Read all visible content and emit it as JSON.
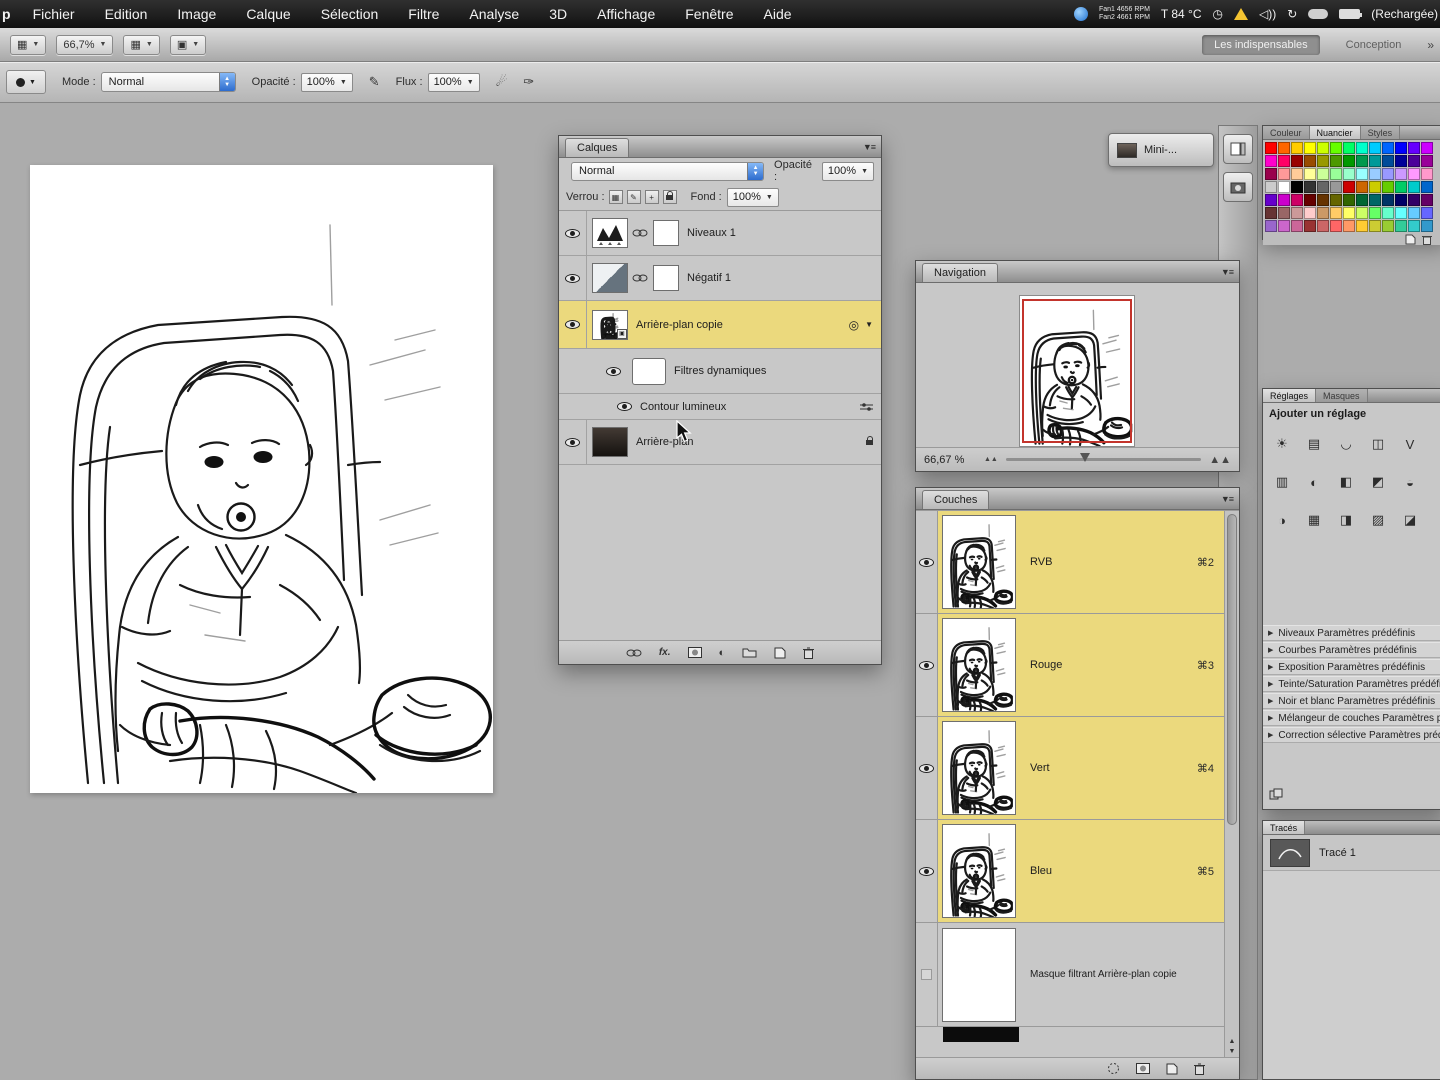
{
  "menu_bar": {
    "app_partial": "p",
    "items": [
      "Fichier",
      "Edition",
      "Image",
      "Calque",
      "Sélection",
      "Filtre",
      "Analyse",
      "3D",
      "Affichage",
      "Fenêtre",
      "Aide"
    ],
    "status": {
      "fan_line1": "Fan1 4656 RPM",
      "fan_line2": "Fan2 4661 RPM",
      "temperature": "T 84 °C",
      "battery_text": "(Rechargée)"
    }
  },
  "app_bar": {
    "zoom_value": "66,7%",
    "workspace_buttons": [
      "Les indispensables",
      "Conception"
    ],
    "overflow_icon": "»"
  },
  "options_bar": {
    "mode_label": "Mode :",
    "mode_value": "Normal",
    "opacity_label": "Opacité :",
    "opacity_value": "100%",
    "flow_label": "Flux :",
    "flow_value": "100%"
  },
  "mini_bridge_button": {
    "label": "Mini-..."
  },
  "layers_panel": {
    "tab": "Calques",
    "blend_mode": "Normal",
    "opacity_label": "Opacité :",
    "opacity_value": "100%",
    "lock_label": "Verrou :",
    "fill_label": "Fond :",
    "fill_value": "100%",
    "layers": [
      {
        "name": "Niveaux 1"
      },
      {
        "name": "Négatif 1"
      },
      {
        "name": "Arrière-plan copie"
      },
      {
        "name": "Filtres dynamiques"
      },
      {
        "name": "Contour lumineux"
      },
      {
        "name": "Arrière-plan"
      }
    ]
  },
  "navigator_panel": {
    "tab": "Navigation",
    "zoom_value": "66,67 %"
  },
  "channels_panel": {
    "tab": "Couches",
    "channels": [
      {
        "name": "RVB",
        "shortcut": "⌘2"
      },
      {
        "name": "Rouge",
        "shortcut": "⌘3"
      },
      {
        "name": "Vert",
        "shortcut": "⌘4"
      },
      {
        "name": "Bleu",
        "shortcut": "⌘5"
      },
      {
        "name": "Masque filtrant Arrière-plan copie",
        "shortcut": ""
      }
    ]
  },
  "swatches_panel": {
    "tabs": [
      "Couleur",
      "Nuancier",
      "Styles"
    ],
    "palette": [
      "#ff0000",
      "#ff6600",
      "#ffcc00",
      "#ffff00",
      "#ccff00",
      "#66ff00",
      "#00ff66",
      "#00ffcc",
      "#00ccff",
      "#0066ff",
      "#0000ff",
      "#6600ff",
      "#cc00ff",
      "#ff00cc",
      "#ff0066",
      "#990000",
      "#994c00",
      "#999900",
      "#4c9900",
      "#009900",
      "#00994c",
      "#009999",
      "#004c99",
      "#000099",
      "#4c0099",
      "#990099",
      "#99004c",
      "#ff9999",
      "#ffcc99",
      "#ffff99",
      "#ccff99",
      "#99ff99",
      "#99ffcc",
      "#99ffff",
      "#99ccff",
      "#9999ff",
      "#cc99ff",
      "#ff99ff",
      "#ff99cc",
      "#cccccc",
      "#ffffff",
      "#000000",
      "#333333",
      "#666666",
      "#999999",
      "#cc0000",
      "#cc6600",
      "#cccc00",
      "#66cc00",
      "#00cc66",
      "#00cccc",
      "#0066cc",
      "#6600cc",
      "#cc00cc",
      "#cc0066",
      "#660000",
      "#663300",
      "#666600",
      "#336600",
      "#006633",
      "#006666",
      "#003366",
      "#000066",
      "#330066",
      "#660066",
      "#663333",
      "#996666",
      "#cc9999",
      "#ffcccc",
      "#cc9966",
      "#ffcc66",
      "#ffff66",
      "#ccff66",
      "#66ff66",
      "#66ffcc",
      "#66ffff",
      "#66ccff",
      "#6666ff",
      "#9966cc",
      "#cc66cc",
      "#cc6699",
      "#993333",
      "#cc6666",
      "#ff6666",
      "#ff9966",
      "#ffcc33",
      "#cccc33",
      "#99cc33",
      "#33cc99",
      "#33cccc",
      "#3399cc"
    ]
  },
  "adjustments_panel": {
    "tabs": [
      "Réglages",
      "Masques"
    ],
    "heading": "Ajouter un réglage",
    "icons": [
      {
        "name": "brightness-contrast",
        "glyph": "☀"
      },
      {
        "name": "levels",
        "glyph": "▤"
      },
      {
        "name": "curves",
        "glyph": "◡"
      },
      {
        "name": "exposure",
        "glyph": "◫"
      },
      {
        "name": "vibrance",
        "glyph": "V"
      },
      {
        "name": "hue-saturation",
        "glyph": "▥"
      },
      {
        "name": "color-balance",
        "glyph": "◐"
      },
      {
        "name": "black-white",
        "glyph": "◧"
      },
      {
        "name": "photo-filter",
        "glyph": "◩"
      },
      {
        "name": "channel-mixer",
        "glyph": "◒"
      },
      {
        "name": "invert",
        "glyph": "◑"
      },
      {
        "name": "posterize",
        "glyph": "▦"
      },
      {
        "name": "threshold",
        "glyph": "◨"
      },
      {
        "name": "gradient-map",
        "glyph": "▨"
      },
      {
        "name": "selective-color",
        "glyph": "◪"
      }
    ],
    "presets": [
      "Niveaux Paramètres prédéfinis",
      "Courbes Paramètres prédéfinis",
      "Exposition Paramètres prédéfinis",
      "Teinte/Saturation Paramètres prédéfinis",
      "Noir et blanc Paramètres prédéfinis",
      "Mélangeur de couches Paramètres prédéfinis",
      "Correction sélective Paramètres prédéfinis"
    ]
  },
  "paths_panel": {
    "tab": "Tracés",
    "items": [
      {
        "name": "Tracé 1"
      }
    ]
  },
  "colors": {
    "selection_yellow": "#ebd97d",
    "navigator_frame_red": "#c3342c"
  }
}
